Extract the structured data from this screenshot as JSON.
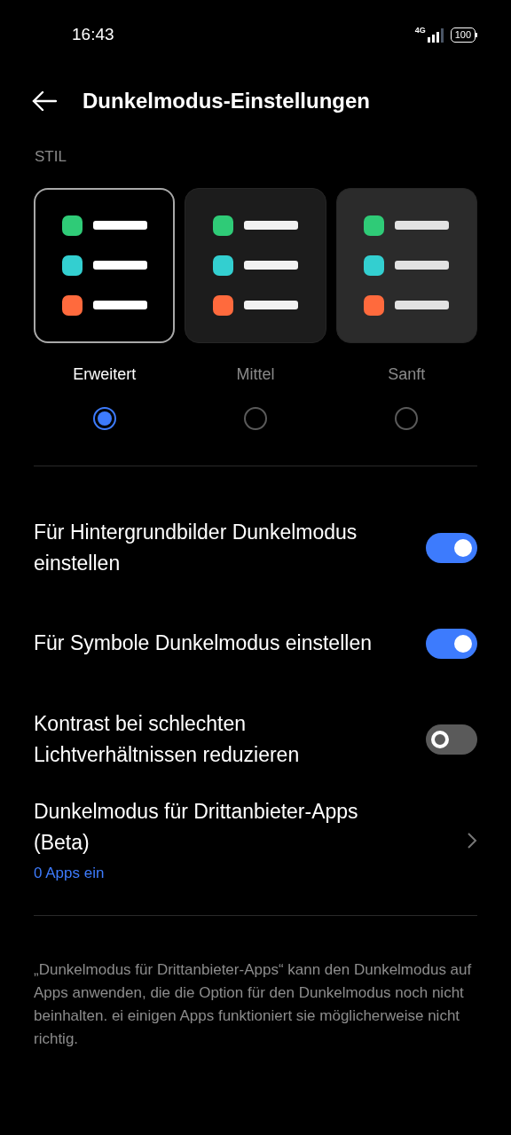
{
  "status_bar": {
    "time": "16:43",
    "network": "4G",
    "battery": "100"
  },
  "header": {
    "title": "Dunkelmodus-Einstellungen"
  },
  "section_label": "STIL",
  "styles": [
    {
      "label": "Erweitert",
      "selected": true
    },
    {
      "label": "Mittel",
      "selected": false
    },
    {
      "label": "Sanft",
      "selected": false
    }
  ],
  "settings": [
    {
      "kind": "toggle",
      "label": "Für Hintergrundbilder Dunkelmodus einstellen",
      "on": true
    },
    {
      "kind": "toggle",
      "label": "Für Symbole Dunkelmodus einstellen",
      "on": true
    },
    {
      "kind": "toggle",
      "label": "Kontrast bei schlechten Lichtverhältnissen reduzieren",
      "on": false
    },
    {
      "kind": "link",
      "label": "Dunkelmodus für Drittanbieter-Apps (Beta)",
      "subtitle": "0 Apps ein"
    }
  ],
  "footer_note": "„Dunkelmodus für Drittanbieter-Apps“ kann den Dunkelmodus auf Apps anwenden, die die Option für den Dunkelmodus noch nicht beinhalten. ei einigen Apps funktioniert sie möglicherweise nicht richtig."
}
